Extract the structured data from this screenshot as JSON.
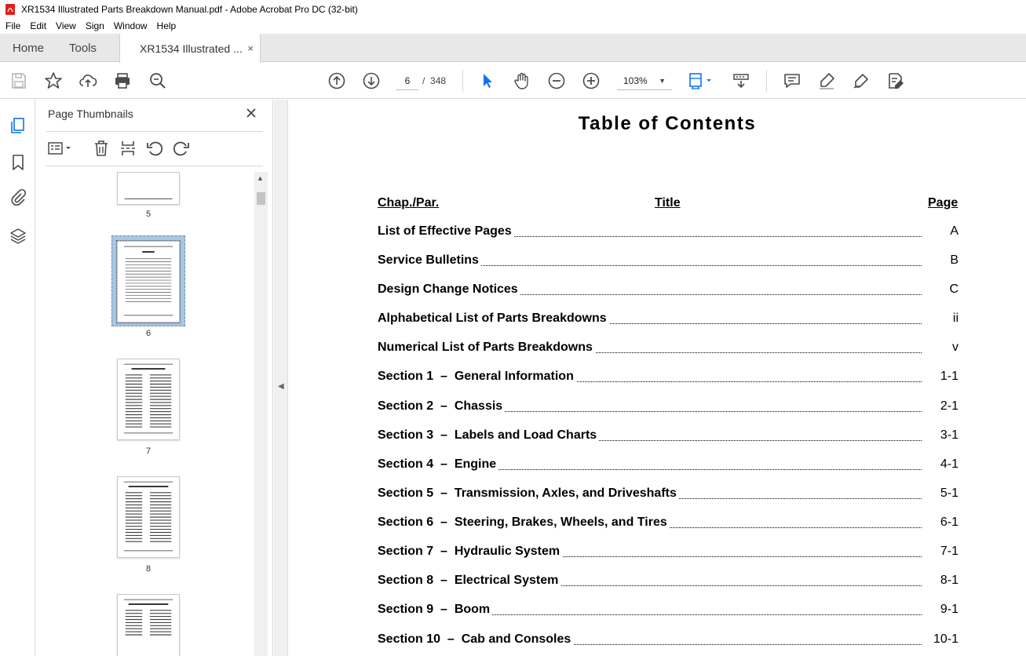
{
  "window": {
    "title": "XR1534 Illustrated Parts Breakdown Manual.pdf - Adobe Acrobat Pro DC (32-bit)"
  },
  "menu": [
    "File",
    "Edit",
    "View",
    "Sign",
    "Window",
    "Help"
  ],
  "tabs": {
    "home": "Home",
    "tools": "Tools",
    "document": "XR1534 Illustrated ...",
    "close": "×"
  },
  "toolbar": {
    "current_page": "6",
    "page_separator": "/",
    "total_pages": "348",
    "zoom": "103%"
  },
  "panel": {
    "title": "Page Thumbnails",
    "thumbnails": [
      {
        "label": "5"
      },
      {
        "label": "6",
        "selected": true
      },
      {
        "label": "7"
      },
      {
        "label": "8"
      },
      {
        "label": ""
      }
    ]
  },
  "document": {
    "title": "Table of Contents",
    "headers": {
      "chap": "Chap./Par.",
      "title": "Title",
      "page": "Page"
    },
    "entries": [
      {
        "label": "List of Effective Pages",
        "page": "A"
      },
      {
        "label": "Service Bulletins",
        "page": "B"
      },
      {
        "label": "Design Change Notices",
        "page": "C"
      },
      {
        "label": "Alphabetical List of Parts Breakdowns",
        "page": "ii"
      },
      {
        "label": "Numerical List of Parts Breakdowns",
        "page": "v"
      },
      {
        "label": "Section 1  –  General Information",
        "page": "1-1"
      },
      {
        "label": "Section 2  –  Chassis",
        "page": "2-1"
      },
      {
        "label": "Section 3  –  Labels and Load Charts",
        "page": "3-1"
      },
      {
        "label": "Section 4  –  Engine",
        "page": "4-1"
      },
      {
        "label": "Section 5  –  Transmission, Axles, and Driveshafts",
        "page": "5-1"
      },
      {
        "label": "Section 6  –  Steering, Brakes, Wheels, and Tires",
        "page": "6-1"
      },
      {
        "label": "Section 7  –  Hydraulic System",
        "page": "7-1"
      },
      {
        "label": "Section 8  –  Electrical System",
        "page": "8-1"
      },
      {
        "label": "Section 9  –  Boom",
        "page": "9-1"
      },
      {
        "label": "Section 10  –  Cab and Consoles",
        "page": "10-1"
      }
    ]
  },
  "colors": {
    "accent_blue": "#1473e6",
    "icon_gray": "#4b4b4b",
    "pdf_red": "#e0201b",
    "selection_blue": "#a9c7e3"
  }
}
